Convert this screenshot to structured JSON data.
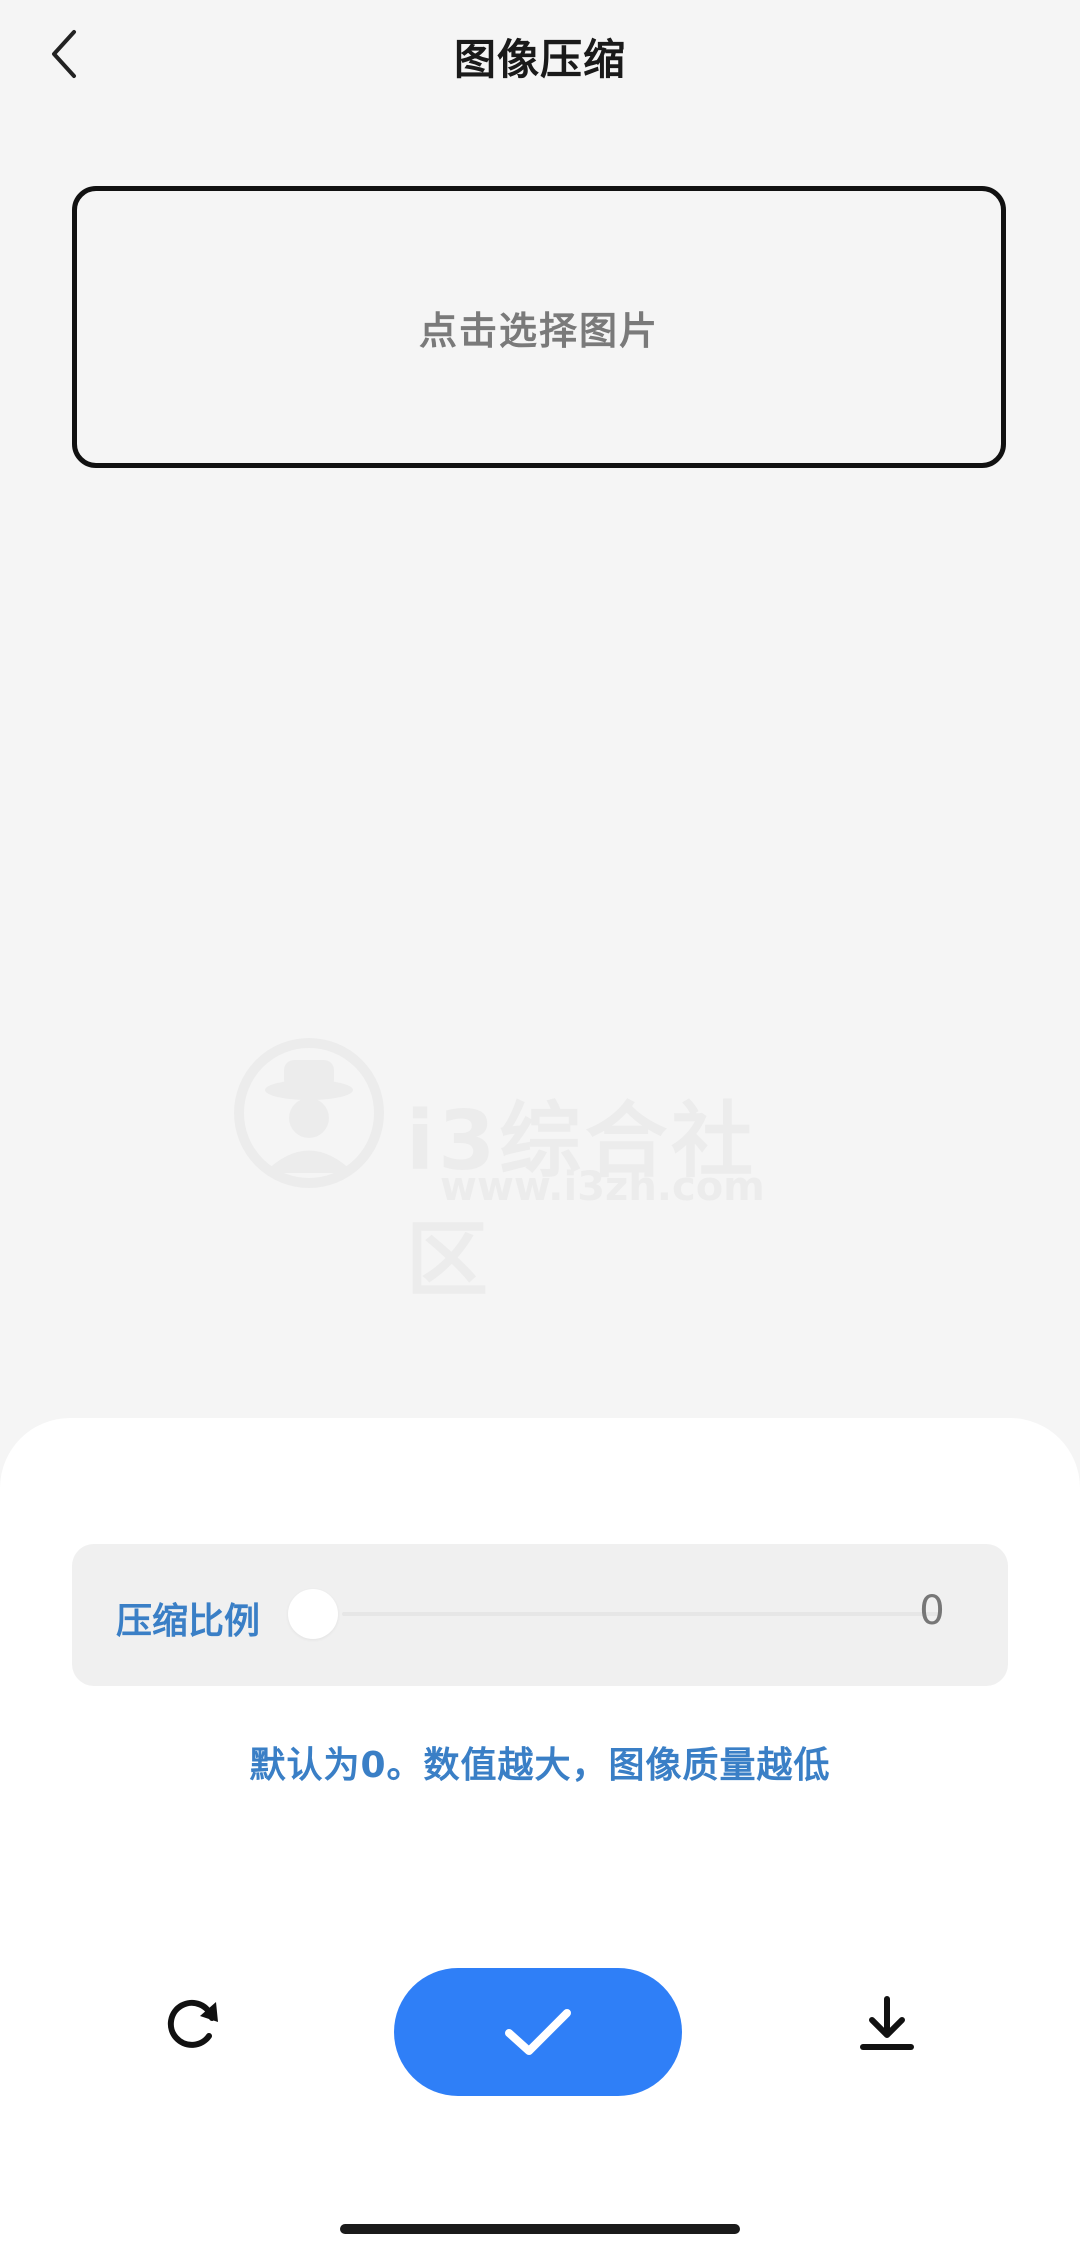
{
  "header": {
    "title": "图像压缩",
    "back_icon": "chevron-left-icon"
  },
  "picker": {
    "label": "点击选择图片"
  },
  "watermark": {
    "name": "i3综合社区",
    "url": "www.i3zh.com"
  },
  "compression": {
    "label": "压缩比例",
    "value": "0",
    "level": 0,
    "hint": "默认为0。数值越大，图像质量越低"
  },
  "actions": {
    "reset_icon": "refresh-icon",
    "confirm_icon": "check-icon",
    "download_icon": "download-icon"
  },
  "colors": {
    "accent": "#2f7ff7",
    "label_blue": "#3a7fc6",
    "background": "#f5f5f5",
    "sheet": "#ffffff"
  }
}
